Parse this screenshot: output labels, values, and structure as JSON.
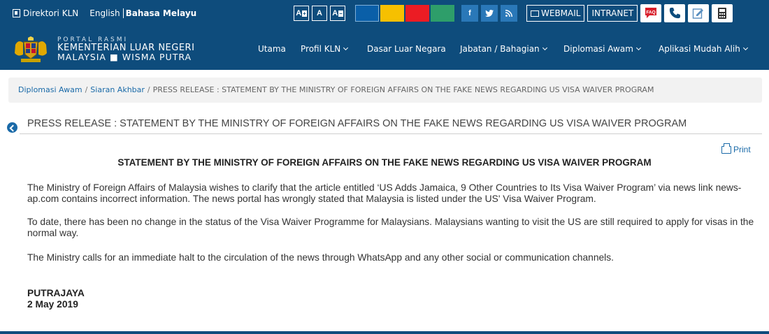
{
  "topbar": {
    "directory_label": "Direktori KLN",
    "lang_english": "English",
    "lang_malay": "Bahasa Melayu",
    "font_increase": "A",
    "font_normal": "A",
    "font_decrease": "A",
    "theme_colors": [
      "#0a5fa8",
      "#f6c000",
      "#ec1c24",
      "#2e9e6a"
    ],
    "social": [
      {
        "icon": "facebook-icon",
        "glyph": "f"
      },
      {
        "icon": "twitter-icon",
        "glyph": "t"
      },
      {
        "icon": "rss-icon",
        "glyph": "≈"
      }
    ],
    "webmail_label": "WEBMAIL",
    "intranet_label": "INTRANET",
    "tools": [
      "faq-icon",
      "phone-icon",
      "feedback-icon",
      "calculator-icon"
    ]
  },
  "header": {
    "logo_line1": "PORTAL RASMI",
    "logo_line2": "KEMENTERIAN LUAR NEGERI",
    "logo_line3": "MALAYSIA ■ WISMA PUTRA",
    "nav": [
      {
        "label": "Utama",
        "dropdown": false
      },
      {
        "label": "Profil KLN",
        "dropdown": true
      },
      {
        "label": "Dasar Luar Negara",
        "dropdown": false
      },
      {
        "label": "Jabatan / Bahagian",
        "dropdown": true
      },
      {
        "label": "Diplomasi Awam",
        "dropdown": true
      },
      {
        "label": "Aplikasi Mudah Alih",
        "dropdown": true
      }
    ]
  },
  "breadcrumb": {
    "items": [
      "Diplomasi Awam",
      "Siaran Akhbar"
    ],
    "current": "PRESS RELEASE : STATEMENT BY THE MINISTRY OF FOREIGN AFFAIRS ON THE FAKE NEWS REGARDING US VISA WAIVER PROGRAM"
  },
  "page": {
    "title": "PRESS RELEASE : STATEMENT BY THE MINISTRY OF FOREIGN AFFAIRS ON THE FAKE NEWS REGARDING US VISA WAIVER PROGRAM",
    "print_label": "Print"
  },
  "article": {
    "heading": "STATEMENT BY THE MINISTRY OF FOREIGN AFFAIRS ON THE FAKE NEWS REGARDING US VISA WAIVER PROGRAM",
    "paragraphs": [
      "The Ministry of Foreign Affairs of Malaysia wishes to clarify that the article entitled ‘US Adds Jamaica, 9 Other Countries to Its Visa Waiver Program’ via news link news-ap.com contains incorrect information. The news portal has wrongly stated that Malaysia is listed under the US' Visa Waiver Program.",
      "To date, there has been no change in the status of the Visa Waiver Programme for Malaysians. Malaysians wanting to visit the US are still required to apply for visas in the normal way.",
      "The Ministry calls for an immediate halt to the circulation of the news through WhatsApp and any other social or communication channels."
    ],
    "place": "PUTRAJAYA",
    "date": "2 May 2019"
  }
}
